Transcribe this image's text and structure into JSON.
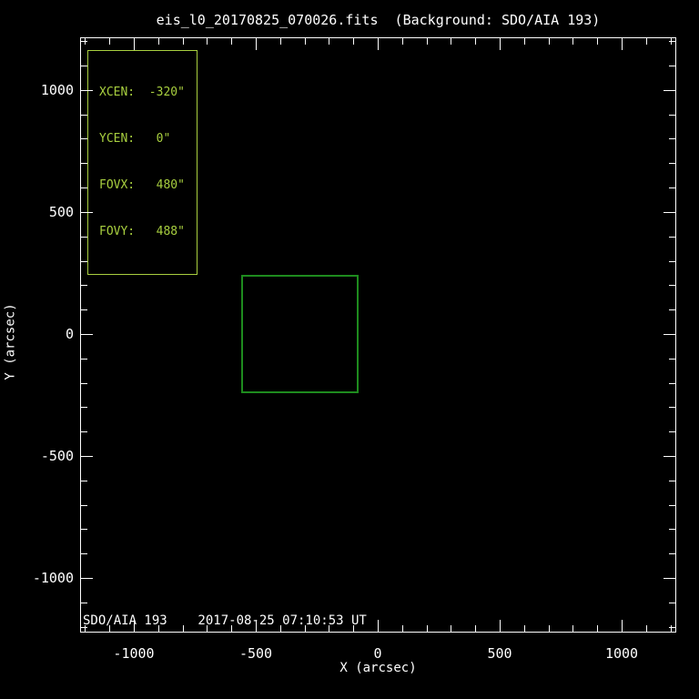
{
  "window": {
    "title": "eis_l0_20170825_070026.fits  (Background: SDO/AIA 193)"
  },
  "chart_data": {
    "type": "scatter",
    "title": "eis_l0_20170825_070026.fits  (Background: SDO/AIA 193)",
    "xlabel": "X (arcsec)",
    "ylabel": "Y (arcsec)",
    "xlim": [
      -1216,
      1220
    ],
    "ylim": [
      -1220,
      1212
    ],
    "x_ticks": [
      -1000,
      -500,
      0,
      500,
      1000
    ],
    "y_ticks": [
      -1000,
      -500,
      0,
      500,
      1000
    ],
    "minor_tick_interval": 100,
    "grid": false,
    "background_color": "#000000",
    "axis_color": "#ffffff",
    "fov_box": {
      "xcen": -320,
      "ycen": 0,
      "fovx": 480,
      "fovy": 488,
      "color": "#1e8b1e"
    },
    "info_box": {
      "color": "#a8cf3f",
      "lines": [
        "XCEN:  -320\"",
        "YCEN:   0\"",
        "FOVX:   480\"",
        "FOVY:   488\""
      ]
    },
    "annotation": "SDO/AIA 193    2017-08-25 07:10:53 UT"
  }
}
